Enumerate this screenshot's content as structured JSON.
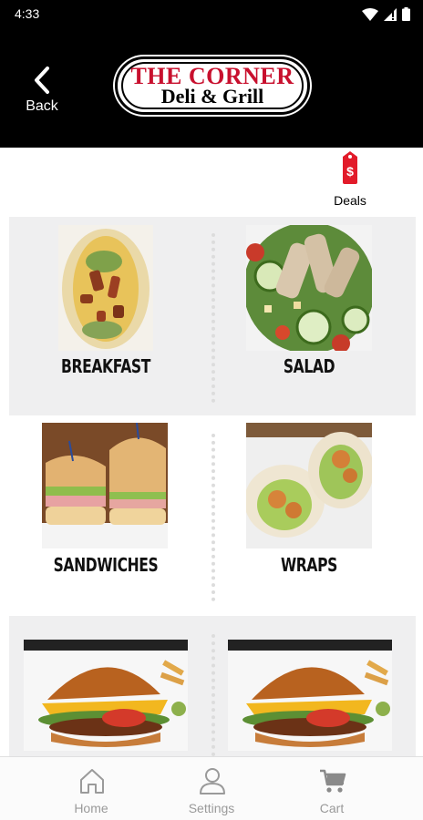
{
  "status_bar": {
    "time": "4:33"
  },
  "header": {
    "back_label": "Back",
    "logo_line1": "THE CORNER",
    "logo_line2": "Deli & Grill"
  },
  "deals": {
    "label": "Deals"
  },
  "categories": [
    {
      "label": "BREAKFAST"
    },
    {
      "label": "SALAD"
    },
    {
      "label": "SANDWICHES"
    },
    {
      "label": "WRAPS"
    },
    {
      "label": ""
    },
    {
      "label": ""
    }
  ],
  "bottom_nav": {
    "items": [
      {
        "label": "Home",
        "icon": "home-icon"
      },
      {
        "label": "Settings",
        "icon": "user-icon"
      },
      {
        "label": "Cart",
        "icon": "cart-icon"
      }
    ]
  },
  "colors": {
    "brand_red": "#c8102e",
    "header_bg": "#000000",
    "row_gray": "#efeff0"
  }
}
